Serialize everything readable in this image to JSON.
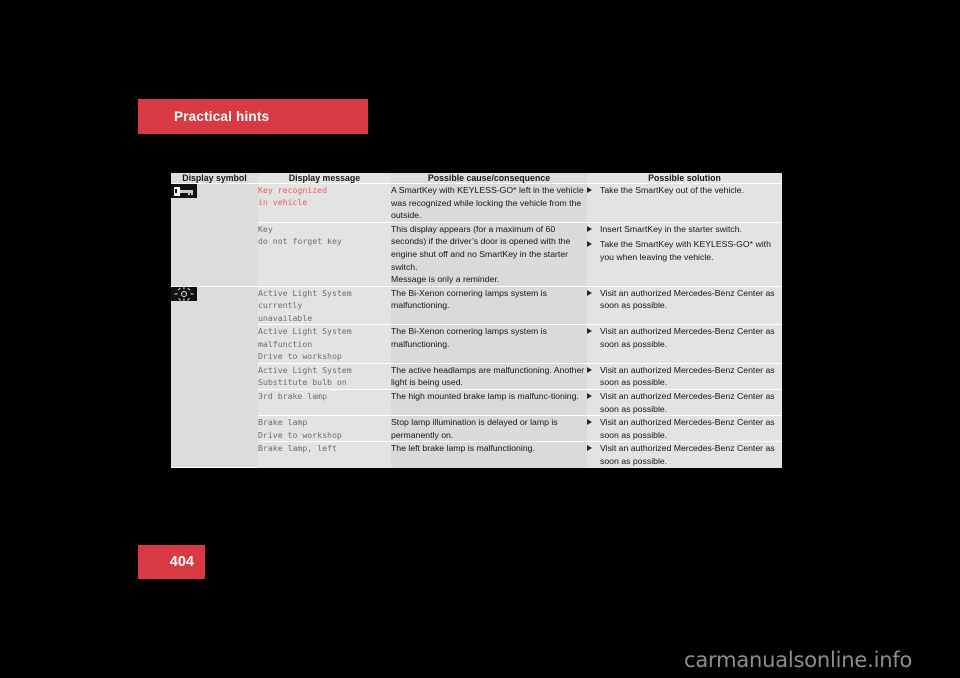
{
  "chapter": {
    "banner_label": "Practical hints"
  },
  "page": {
    "number": "404"
  },
  "watermark": {
    "text": "carmanualsonline.info"
  },
  "table": {
    "headers": {
      "symbol": "Display symbol",
      "message": "Display message",
      "cause": "Possible cause/consequence",
      "solution": "Possible solution"
    },
    "groups": [
      {
        "symbol_icon": "key-symbol-icon",
        "rows": [
          {
            "message": "Key recognized\nin vehicle",
            "message_alert": true,
            "cause": "A SmartKey with KEYLESS-GO* left in the vehicle was recognized while locking the vehicle from the outside.",
            "solutions": [
              "Take the SmartKey out of the vehicle."
            ]
          },
          {
            "message": "Key\ndo not forget key",
            "message_alert": false,
            "cause": "This display appears (for a maximum of 60 seconds) if the driver’s door is opened with the engine shut off and no SmartKey in the starter switch.\nMessage is only a reminder.",
            "solutions": [
              "Insert SmartKey in the starter switch.",
              "Take the SmartKey with KEYLESS-GO* with you when leaving the vehicle."
            ]
          }
        ]
      },
      {
        "symbol_icon": "lamp-symbol-icon",
        "rows": [
          {
            "message": "Active Light System\ncurrently\nunavailable",
            "message_alert": false,
            "cause": "The Bi-Xenon cornering lamps system is malfunctioning.",
            "solutions": [
              "Visit an authorized Mercedes-Benz Center as soon as possible."
            ]
          },
          {
            "message": "Active Light System\nmalfunction\nDrive to workshop",
            "message_alert": false,
            "cause": "The Bi-Xenon cornering lamps system is malfunctioning.",
            "solutions": [
              "Visit an authorized Mercedes-Benz Center as soon as possible."
            ]
          },
          {
            "message": "Active Light System\nSubstitute bulb on",
            "message_alert": false,
            "cause": "The active headlamps are malfunctioning. Another light is being used.",
            "solutions": [
              "Visit an authorized Mercedes-Benz Center as soon as possible."
            ]
          },
          {
            "message": "3rd brake lamp",
            "message_alert": false,
            "cause": "The high mounted brake lamp is malfunc-tioning.",
            "solutions": [
              "Visit an authorized Mercedes-Benz Center as soon as possible."
            ]
          },
          {
            "message": "Brake lamp\nDrive to workshop",
            "message_alert": false,
            "cause": "Stop lamp illumination is delayed or lamp is permanently on.",
            "solutions": [
              "Visit an authorized Mercedes-Benz Center as soon as possible."
            ]
          },
          {
            "message": "Brake lamp, left",
            "message_alert": false,
            "cause": "The left brake lamp is malfunctioning.",
            "solutions": [
              "Visit an authorized Mercedes-Benz Center as soon as possible."
            ]
          }
        ]
      }
    ]
  },
  "colors": {
    "accent_red": "#d93943",
    "alert_text": "#ef5a5f",
    "table_light": "#e3e3e3",
    "table_shade": "#dadada"
  }
}
